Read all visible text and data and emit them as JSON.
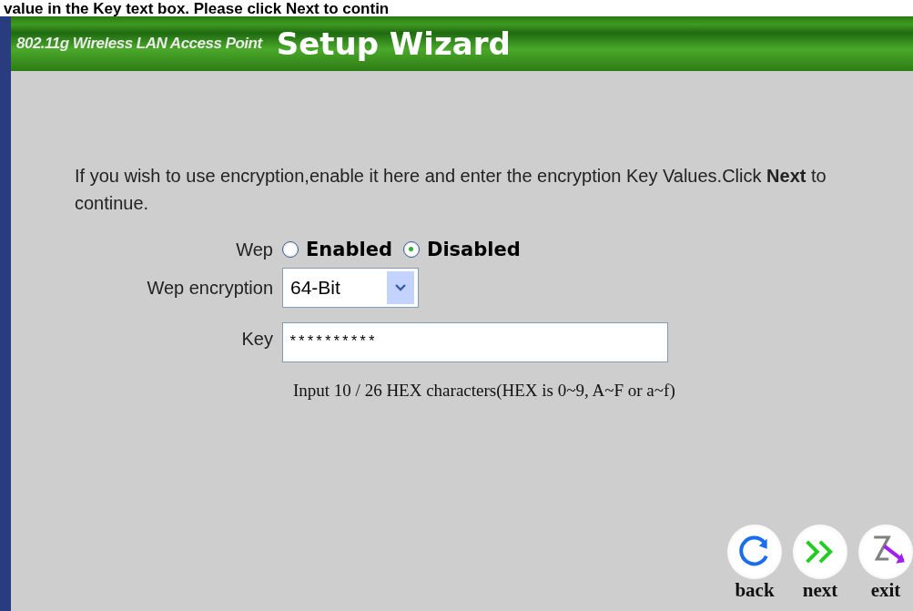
{
  "top_caption": "value in the Key text box. Please click Next to contin",
  "banner": {
    "subtitle": "802.11g Wireless LAN Access Point",
    "title": "Setup Wizard"
  },
  "intro": "If you wish to use encryption,enable it here and enter the encryption Key Values.Click **Next** to continue.",
  "wep": {
    "label": "Wep",
    "options": [
      {
        "label": "Enabled",
        "selected": false
      },
      {
        "label": "Disabled",
        "selected": true
      }
    ]
  },
  "encryption": {
    "label": "Wep encryption",
    "value": "64-Bit"
  },
  "key": {
    "label": "Key",
    "value": "**********"
  },
  "hint": "Input 10 / 26 HEX characters(HEX is 0~9, A~F or a~f)",
  "nav_buttons": [
    {
      "kind": "back",
      "label": "back"
    },
    {
      "kind": "next",
      "label": "next"
    },
    {
      "kind": "exit",
      "label": "exit"
    }
  ]
}
